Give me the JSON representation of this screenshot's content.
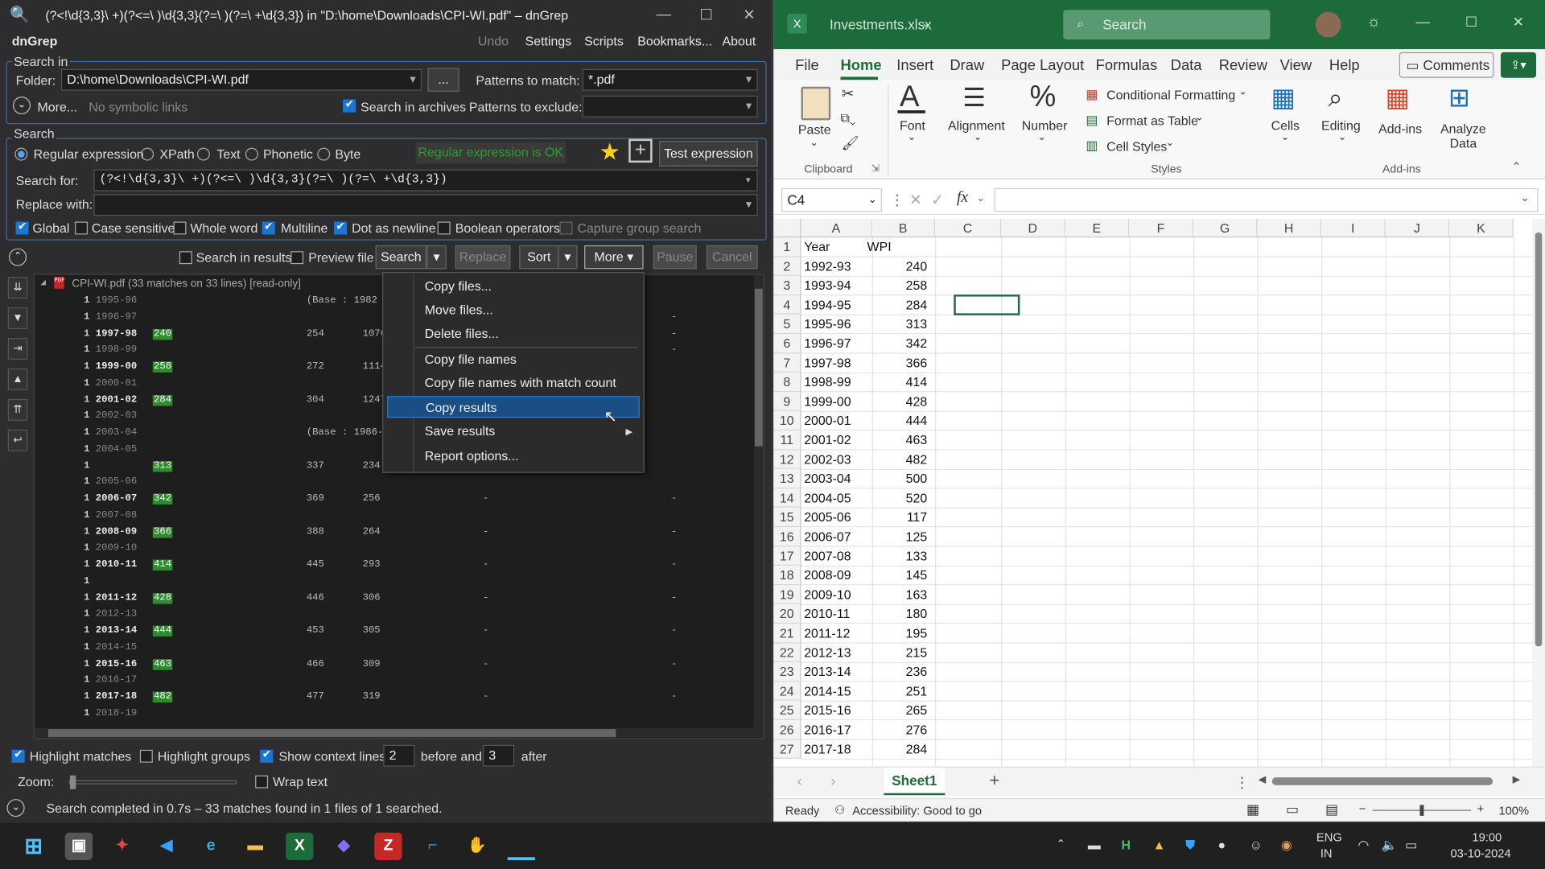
{
  "dngrep": {
    "title": "(?<!\\d{3,3}\\ +)(?<=\\ )\\d{3,3}(?=\\ )(?=\\ +\\d{3,3}) in \"D:\\home\\Downloads\\CPI-WI.pdf\" – dnGrep",
    "app_name": "dnGrep",
    "menu": [
      "Undo",
      "Settings",
      "Scripts",
      "Bookmarks...",
      "About"
    ],
    "search_in_label": "Search in",
    "folder_label": "Folder:",
    "folder_value": "D:\\home\\Downloads\\CPI-WI.pdf",
    "browse_label": "...",
    "patterns_match_label": "Patterns to match:",
    "patterns_match_value": "*.pdf",
    "more_label": "More...",
    "no_symbolic": "No symbolic links",
    "search_archives": "Search in archives",
    "patterns_exclude_label": "Patterns to exclude:",
    "search_group_label": "Search",
    "types": [
      "Regular expression",
      "XPath",
      "Text",
      "Phonetic",
      "Byte"
    ],
    "regex_ok": "Regular expression is OK",
    "test_expression": "Test expression",
    "search_for_label": "Search for:",
    "search_for_value": "(?<!\\d{3,3}\\ +)(?<=\\ )\\d{3,3}(?=\\ )(?=\\ +\\d{3,3})",
    "replace_with_label": "Replace with:",
    "options": [
      "Global",
      "Case sensitive",
      "Whole word",
      "Multiline",
      "Dot as newline",
      "Boolean operators",
      "Capture group search"
    ],
    "search_in_results": "Search in results",
    "preview_file": "Preview file",
    "btn_search": "Search",
    "btn_replace": "Replace",
    "btn_sort": "Sort",
    "btn_more": "More",
    "btn_pause": "Pause",
    "btn_cancel": "Cancel",
    "file_header": "CPI-WI.pdf (33 matches on 33 lines) [read-only]",
    "results": [
      {
        "n": "1",
        "y": "1995-96",
        "m": "",
        "a": "(Base : 1982 = 100 for IW and 1960 - 61 =",
        "b": "",
        "c": "",
        "d": ""
      },
      {
        "n": "1",
        "y": "1996-97",
        "m": "",
        "a": "",
        "b": "",
        "c": "",
        "d": "-"
      },
      {
        "n": "1",
        "y": "1997-98",
        "m": "240",
        "a": "254",
        "b": "1076",
        "c": "",
        "d": "-"
      },
      {
        "n": "1",
        "y": "1998-99",
        "m": "",
        "a": "",
        "b": "",
        "c": "",
        "d": "-"
      },
      {
        "n": "1",
        "y": "1999-00",
        "m": "258",
        "a": "272",
        "b": "1114",
        "c": "",
        "d": ""
      },
      {
        "n": "1",
        "y": "2000-01",
        "m": "",
        "a": "",
        "b": "",
        "c": "",
        "d": ""
      },
      {
        "n": "1",
        "y": "2001-02",
        "m": "284",
        "a": "304",
        "b": "1247",
        "c": "",
        "d": ""
      },
      {
        "n": "1",
        "y": "2002-03",
        "m": "",
        "a": "",
        "b": "",
        "c": "",
        "d": ""
      },
      {
        "n": "1",
        "y": "2003-04",
        "m": "",
        "a": "(Base : 1986-8",
        "b": "",
        "c": "",
        "d": ""
      },
      {
        "n": "1",
        "y": "2004-05",
        "m": "",
        "a": "",
        "b": "",
        "c": "",
        "d": ""
      },
      {
        "n": "1",
        "y": "",
        "m": "313",
        "a": "337",
        "b": "234",
        "c": "",
        "d": ""
      },
      {
        "n": "1",
        "y": "2005-06",
        "m": "",
        "a": "",
        "b": "",
        "c": "",
        "d": ""
      },
      {
        "n": "1",
        "y": "2006-07",
        "m": "342",
        "a": "369",
        "b": "256",
        "c": "-",
        "d": "-"
      },
      {
        "n": "1",
        "y": "2007-08",
        "m": "",
        "a": "",
        "b": "",
        "c": "",
        "d": ""
      },
      {
        "n": "1",
        "y": "2008-09",
        "m": "366",
        "a": "388",
        "b": "264",
        "c": "-",
        "d": "-"
      },
      {
        "n": "1",
        "y": "2009-10",
        "m": "",
        "a": "",
        "b": "",
        "c": "",
        "d": ""
      },
      {
        "n": "1",
        "y": "2010-11",
        "m": "414",
        "a": "445",
        "b": "293",
        "c": "-",
        "d": "-"
      },
      {
        "n": "1",
        "y": "",
        "m": "",
        "a": "",
        "b": "",
        "c": "",
        "d": ""
      },
      {
        "n": "1",
        "y": "2011-12",
        "m": "428",
        "a": "446",
        "b": "306",
        "c": "-",
        "d": "-"
      },
      {
        "n": "1",
        "y": "2012-13",
        "m": "",
        "a": "",
        "b": "",
        "c": "",
        "d": ""
      },
      {
        "n": "1",
        "y": "2013-14",
        "m": "444",
        "a": "453",
        "b": "305",
        "c": "-",
        "d": "-"
      },
      {
        "n": "1",
        "y": "2014-15",
        "m": "",
        "a": "",
        "b": "",
        "c": "",
        "d": ""
      },
      {
        "n": "1",
        "y": "2015-16",
        "m": "463",
        "a": "466",
        "b": "309",
        "c": "-",
        "d": "-"
      },
      {
        "n": "1",
        "y": "2016-17",
        "m": "",
        "a": "",
        "b": "",
        "c": "",
        "d": ""
      },
      {
        "n": "1",
        "y": "2017-18",
        "m": "482",
        "a": "477",
        "b": "319",
        "c": "-",
        "d": "-"
      },
      {
        "n": "1",
        "y": "2018-19",
        "m": "",
        "a": "",
        "b": "",
        "c": "",
        "d": ""
      }
    ],
    "context_menu": [
      "Copy files...",
      "Move files...",
      "Delete files...",
      "Copy file names",
      "Copy file names with match count",
      "Copy results",
      "Save results",
      "Report options..."
    ],
    "highlight_matches": "Highlight matches",
    "highlight_groups": "Highlight groups",
    "show_context": "Show context lines",
    "before_value": "2",
    "before_label": "before and",
    "after_value": "3",
    "after_label": "after",
    "zoom_label": "Zoom:",
    "wrap_text": "Wrap text",
    "status": "Search completed in 0.7s – 33 matches found in 1 files of 1 searched."
  },
  "excel": {
    "file_name": "Investments.xlsx",
    "search_placeholder": "Search",
    "tabs": [
      "File",
      "Home",
      "Insert",
      "Draw",
      "Page Layout",
      "Formulas",
      "Data",
      "Review",
      "View",
      "Help"
    ],
    "comments": "Comments",
    "paste": "Paste",
    "clipboard": "Clipboard",
    "font": "Font",
    "alignment": "Alignment",
    "number": "Number",
    "conditional_formatting": "Conditional Formatting",
    "format_as_table": "Format as Table",
    "cell_styles": "Cell Styles",
    "styles": "Styles",
    "cells": "Cells",
    "editing": "Editing",
    "addins": "Add-ins",
    "analyze": "Analyze Data",
    "addins_group": "Add-ins",
    "name_box": "C4",
    "fx": "fx",
    "columns": [
      "A",
      "B",
      "C",
      "D",
      "E",
      "F",
      "G",
      "H",
      "I",
      "J",
      "K"
    ],
    "rows": [
      {
        "r": "1",
        "a": "Year",
        "b": "WPI"
      },
      {
        "r": "2",
        "a": "1992-93",
        "b": "240"
      },
      {
        "r": "3",
        "a": "1993-94",
        "b": "258"
      },
      {
        "r": "4",
        "a": "1994-95",
        "b": "284"
      },
      {
        "r": "5",
        "a": "1995-96",
        "b": "313"
      },
      {
        "r": "6",
        "a": "1996-97",
        "b": "342"
      },
      {
        "r": "7",
        "a": "1997-98",
        "b": "366"
      },
      {
        "r": "8",
        "a": "1998-99",
        "b": "414"
      },
      {
        "r": "9",
        "a": "1999-00",
        "b": "428"
      },
      {
        "r": "10",
        "a": "2000-01",
        "b": "444"
      },
      {
        "r": "11",
        "a": "2001-02",
        "b": "463"
      },
      {
        "r": "12",
        "a": "2002-03",
        "b": "482"
      },
      {
        "r": "13",
        "a": "2003-04",
        "b": "500"
      },
      {
        "r": "14",
        "a": "2004-05",
        "b": "520"
      },
      {
        "r": "15",
        "a": "2005-06",
        "b": "117"
      },
      {
        "r": "16",
        "a": "2006-07",
        "b": "125"
      },
      {
        "r": "17",
        "a": "2007-08",
        "b": "133"
      },
      {
        "r": "18",
        "a": "2008-09",
        "b": "145"
      },
      {
        "r": "19",
        "a": "2009-10",
        "b": "163"
      },
      {
        "r": "20",
        "a": "2010-11",
        "b": "180"
      },
      {
        "r": "21",
        "a": "2011-12",
        "b": "195"
      },
      {
        "r": "22",
        "a": "2012-13",
        "b": "215"
      },
      {
        "r": "23",
        "a": "2013-14",
        "b": "236"
      },
      {
        "r": "24",
        "a": "2014-15",
        "b": "251"
      },
      {
        "r": "25",
        "a": "2015-16",
        "b": "265"
      },
      {
        "r": "26",
        "a": "2016-17",
        "b": "276"
      },
      {
        "r": "27",
        "a": "2017-18",
        "b": "284"
      }
    ],
    "sheet": "Sheet1",
    "ready": "Ready",
    "accessibility": "Accessibility: Good to go",
    "zoom": "100%"
  },
  "taskbar": {
    "lang1": "ENG",
    "lang2": "IN",
    "time": "19:00",
    "date": "03-10-2024"
  }
}
